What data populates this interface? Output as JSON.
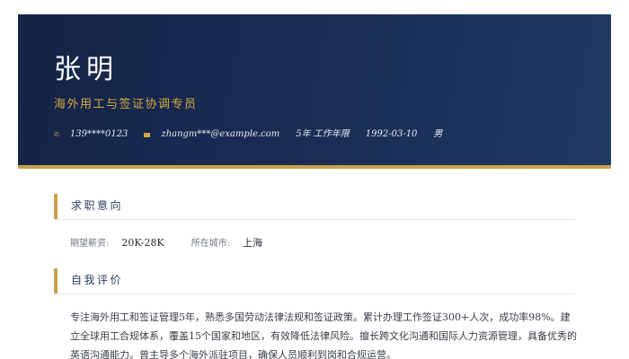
{
  "header": {
    "name": "张明",
    "title": "海外用工与签证协调专员",
    "contact": {
      "phone": "139****0123",
      "email": "zhangm***@example.com",
      "experience": "5年 工作年限",
      "birthdate": "1992-03-10",
      "gender": "男"
    },
    "accent_color": "#c9a24a",
    "background_color": "#1a2e55"
  },
  "job_intention": {
    "section_title": "求职意向",
    "salary_label": "期望薪资:",
    "salary_value": "20K-28K",
    "city_label": "所在城市:",
    "city_value": "上海"
  },
  "self_evaluation": {
    "section_title": "自我评价",
    "text": "专注海外用工和签证管理5年，熟悉多国劳动法律法规和签证政策。累计办理工作签证300+人次，成功率98%。建立全球用工合规体系，覆盖15个国家和地区，有效降低法律风险。擅长跨文化沟通和国际人力资源管理，具备优秀的英语沟通能力。曾主导多个海外派驻项目，确保人员顺利到岗和合规运营。"
  }
}
